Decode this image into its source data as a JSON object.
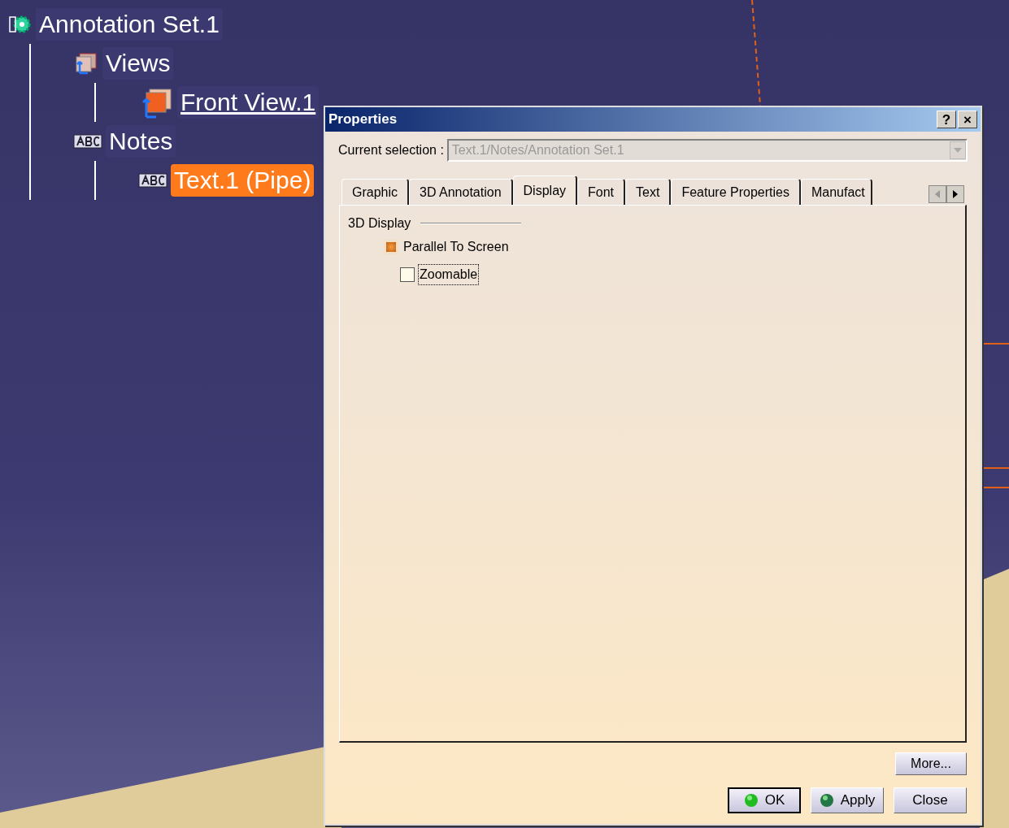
{
  "tree": {
    "label": "Annotation Set.1",
    "selected": false,
    "active": false,
    "kind": "set",
    "children": [
      {
        "label": "Views",
        "selected": false,
        "active": false,
        "kind": "views",
        "children": [
          {
            "label": "Front View.1",
            "selected": false,
            "active": true,
            "kind": "view"
          }
        ]
      },
      {
        "label": "Notes",
        "selected": false,
        "active": false,
        "kind": "notes",
        "children": [
          {
            "label": "Text.1 (Pipe)",
            "selected": true,
            "active": false,
            "kind": "text"
          }
        ]
      }
    ]
  },
  "dialog": {
    "title": "Properties",
    "title_buttons": [
      "?",
      "×"
    ],
    "current_selection": {
      "label": "Current selection :",
      "value": "Text.1/Notes/Annotation Set.1",
      "disabled": true
    },
    "tabs": [
      {
        "label": "Graphic",
        "selected": false
      },
      {
        "label": "3D Annotation",
        "selected": false
      },
      {
        "label": "Display",
        "selected": true
      },
      {
        "label": "Font",
        "selected": false
      },
      {
        "label": "Text",
        "selected": false
      },
      {
        "label": "Feature Properties",
        "selected": false
      },
      {
        "label": "Manufact",
        "selected": false
      }
    ],
    "group": {
      "title": "3D Display",
      "options": [
        {
          "label": "Parallel To Screen",
          "checked": true,
          "focused": false,
          "children": [
            {
              "label": "Zoomable",
              "checked": false,
              "focused": true
            }
          ]
        }
      ]
    },
    "more_button": "More...",
    "buttons": [
      {
        "label": "OK",
        "kind": "default",
        "icon": true
      },
      {
        "label": "Apply",
        "kind": "normal",
        "icon": true
      },
      {
        "label": "Close",
        "kind": "normal",
        "icon": false
      }
    ]
  }
}
